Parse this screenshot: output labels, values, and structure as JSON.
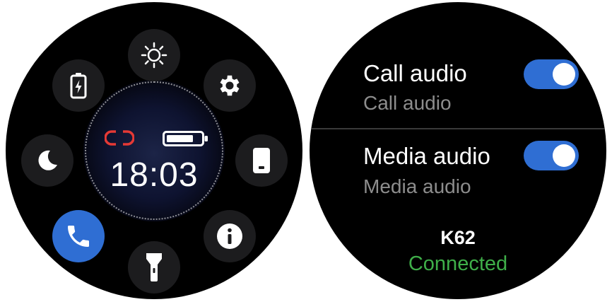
{
  "quick_panel": {
    "time": "18:03",
    "tiles": [
      {
        "name": "brightness",
        "icon": "sun-icon",
        "active": false
      },
      {
        "name": "settings",
        "icon": "gear-icon",
        "active": false
      },
      {
        "name": "find-phone",
        "icon": "phone-icon",
        "active": false
      },
      {
        "name": "about",
        "icon": "info-icon",
        "active": false
      },
      {
        "name": "flashlight",
        "icon": "flashlight-icon",
        "active": false
      },
      {
        "name": "call-audio",
        "icon": "phone-handset-icon",
        "active": true
      },
      {
        "name": "do-not-disturb",
        "icon": "moon-icon",
        "active": false
      },
      {
        "name": "battery-saver",
        "icon": "battery-charging-icon",
        "active": false
      }
    ],
    "status_icons": [
      "disconnected-link-icon",
      "battery-icon"
    ],
    "colors": {
      "active_tile": "#2f6ed3",
      "disconnected": "#e53935",
      "dial_center": "#0e1330"
    }
  },
  "audio_settings": {
    "rows": [
      {
        "title": "Call audio",
        "subtitle": "Call audio",
        "enabled": true
      },
      {
        "title": "Media audio",
        "subtitle": "Media audio",
        "enabled": true
      }
    ],
    "device": {
      "name": "K62",
      "status": "Connected"
    },
    "colors": {
      "toggle_on": "#2f6ed3",
      "connected": "#3fae49",
      "subtitle": "#8d8d8d"
    }
  }
}
